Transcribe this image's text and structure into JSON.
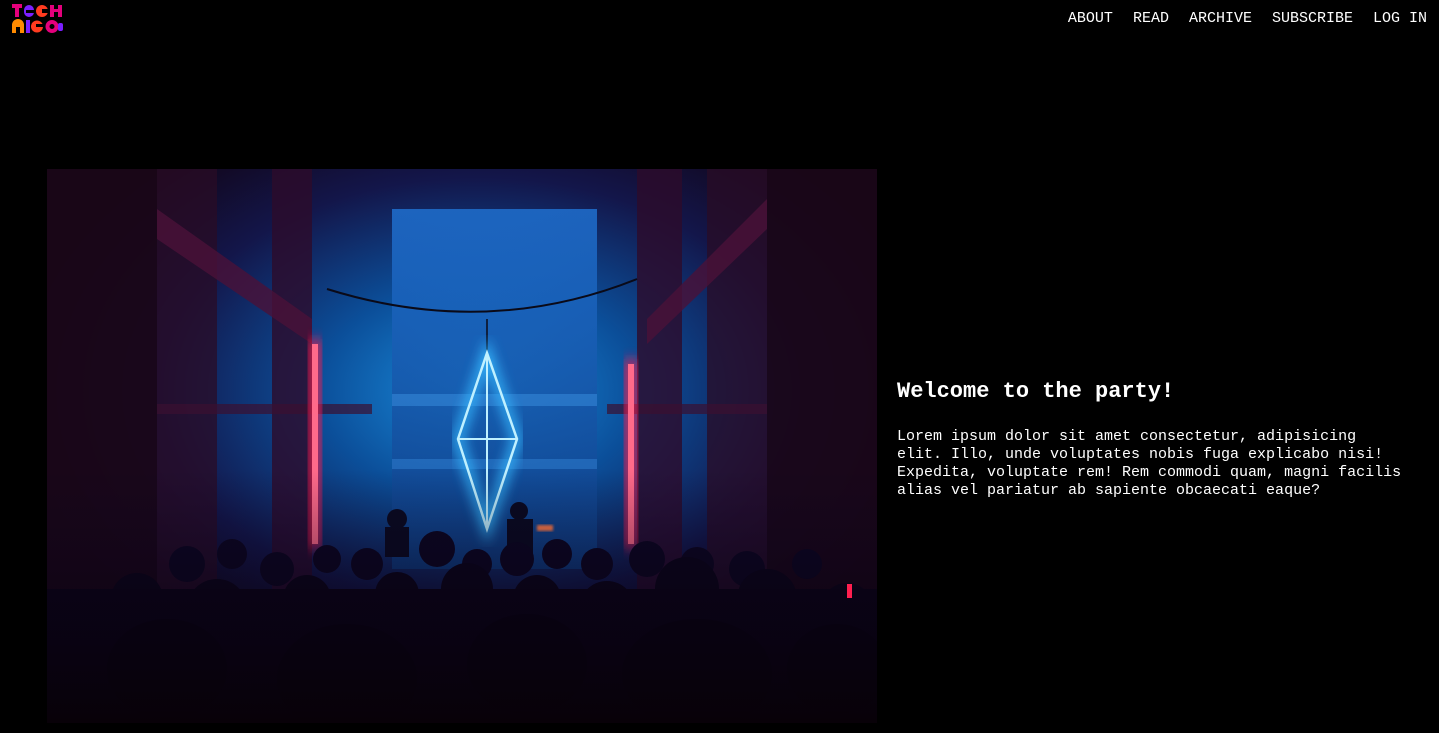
{
  "header": {
    "logo_icon": "techrico-logo-icon",
    "logo_colors": [
      "#e4007c",
      "#7b1fff",
      "#ff8a00",
      "#ff3b1f"
    ],
    "nav": [
      {
        "label": "ABOUT"
      },
      {
        "label": "READ"
      },
      {
        "label": "ARCHIVE"
      },
      {
        "label": "SUBSCRIBE"
      },
      {
        "label": "LOG IN"
      }
    ]
  },
  "hero": {
    "image_icon": "concert-photo",
    "title": "Welcome to the party!",
    "body": "Lorem ipsum dolor sit amet consectetur, adipisicing elit. Illo, unde voluptates nobis fuga explicabo nisi! Expedita, voluptate rem! Rem commodi quam, magni facilis alias vel pariatur ab sapiente obcaecati eaque?"
  },
  "colors": {
    "background": "#000000",
    "text": "#ffffff",
    "neon_blue": "#35b8ff",
    "neon_red": "#ff1f4f"
  }
}
